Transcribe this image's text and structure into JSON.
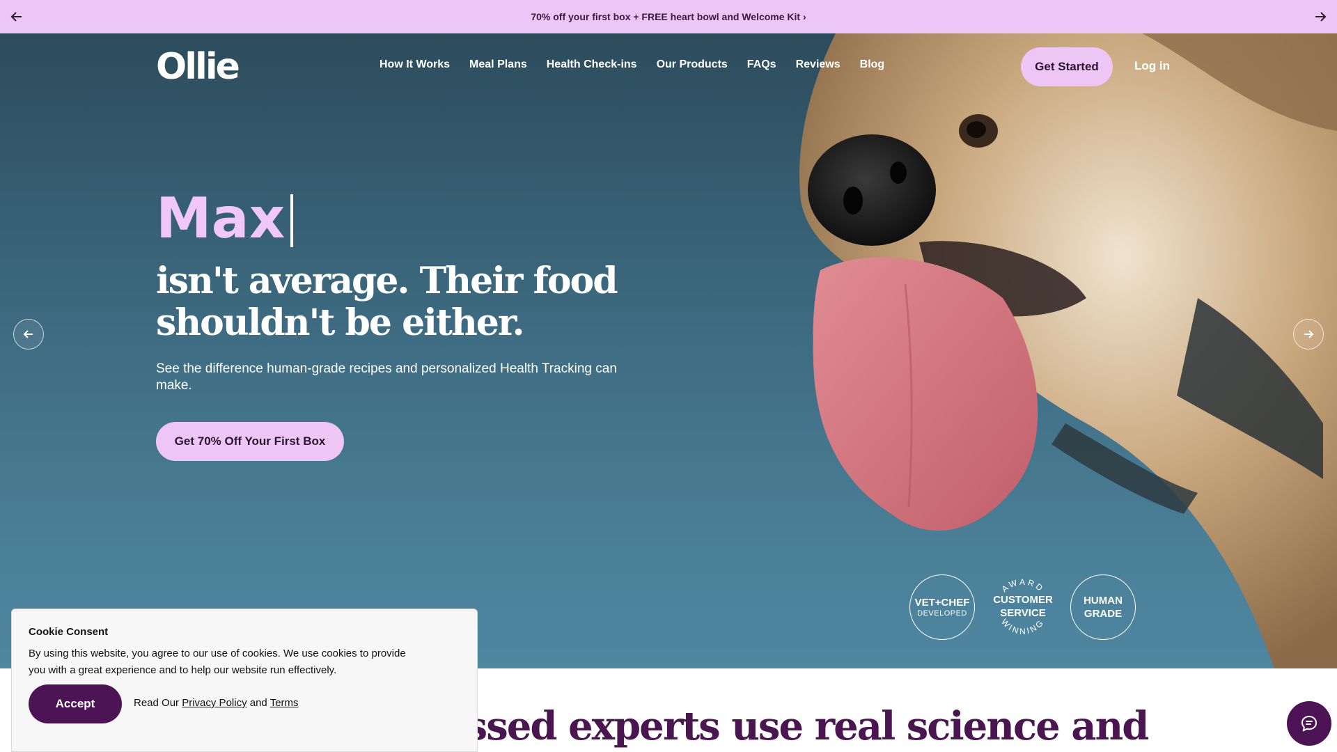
{
  "promo": {
    "text": "70% off your first box + FREE heart bowl and Welcome Kit ›"
  },
  "header": {
    "logo": "Ollie",
    "nav": [
      "How It Works",
      "Meal Plans",
      "Health Check-ins",
      "Our Products",
      "FAQs",
      "Reviews",
      "Blog"
    ],
    "get_started": "Get Started",
    "login": "Log in"
  },
  "hero": {
    "pet_name": "Max",
    "headline": "isn't average. Their food shouldn't be either.",
    "subtext": "See the difference human-grade recipes and personalized Health Tracking can make.",
    "cta": "Get 70% Off Your First Box"
  },
  "badges": {
    "vet_chef": {
      "line1": "VET+CHEF",
      "line2": "DEVELOPED"
    },
    "award": {
      "top": "AWARD",
      "line1": "CUSTOMER",
      "line2": "SERVICE",
      "bottom": "WINNING"
    },
    "human": {
      "line1": "HUMAN",
      "line2": "GRADE"
    }
  },
  "section": {
    "heading": "Our dog-obsessed experts use real science and"
  },
  "cookie": {
    "title": "Cookie Consent",
    "body": "By using this website, you agree to our use of cookies. We use cookies to provide you with a great experience and to help our website run effectively.",
    "accept": "Accept",
    "read_our": "Read Our",
    "privacy": "Privacy Policy",
    "and": "and",
    "terms": "Terms"
  },
  "icons": {
    "promo_prev": "arrow-left-icon",
    "promo_next": "arrow-right-icon",
    "slide_prev": "arrow-left-icon",
    "slide_next": "arrow-right-icon",
    "chat": "chat-bubble-icon"
  },
  "colors": {
    "promo_bg": "#ecc6f6",
    "accent_pink": "#eec6f6",
    "brand_purple": "#4c1455",
    "hero_blue": "#3d6a80"
  }
}
